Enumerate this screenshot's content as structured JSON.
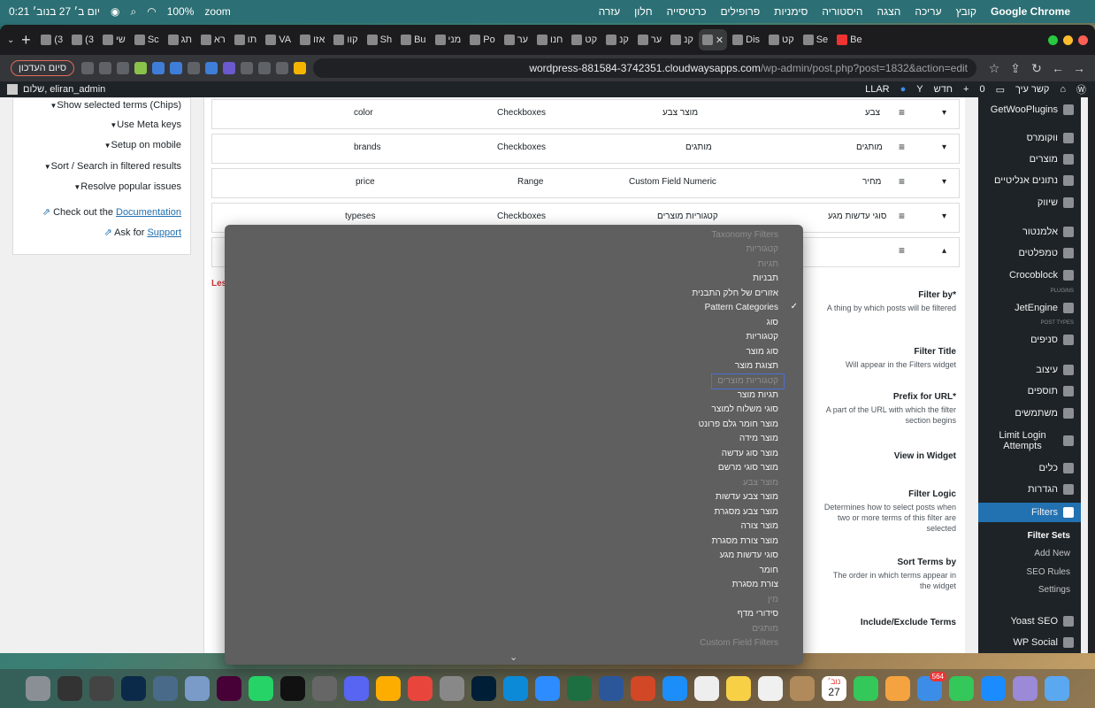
{
  "menubar": {
    "app": "Google Chrome",
    "menus": [
      "קובץ",
      "עריכה",
      "הצגה",
      "היסטוריה",
      "סימניות",
      "פרופילים",
      "כרטיסייה",
      "חלון",
      "עזרה"
    ],
    "status": {
      "zoom": "zoom",
      "battery": "100%",
      "datetime": "יום ב׳ 27 בנוב׳ 0:21"
    }
  },
  "tabs": [
    "Be",
    "Se",
    "קט",
    "Dis",
    "קנ",
    "ער",
    "קנ",
    "קט",
    "חנו",
    "ער",
    "Po",
    "מני",
    "Bu",
    "Sh",
    "קוו",
    "אזו",
    "VA",
    "תו",
    "רא",
    "תג",
    "Sc",
    "שי",
    "(3",
    "(3"
  ],
  "url": {
    "host": "wordpress-881584-3742351.cloudwaysapps.com",
    "path": "/wp-admin/post.php?post=1832&action=edit"
  },
  "profile_button": "סיום העדכון",
  "adminbar": {
    "site": "קשר עיך",
    "comments": "0",
    "new": "חדש",
    "llar": "LLAR",
    "greeting": "שלום, eliran_admin"
  },
  "left_options": [
    "Show selected terms (Chips)",
    "Use Meta keys",
    "Setup on mobile",
    "Sort / Search in filtered results",
    "Resolve popular issues"
  ],
  "links": {
    "doc_text": "Check out the",
    "doc_link": "Documentation",
    "support_text": "Ask for",
    "support_link": "Support"
  },
  "filter_rows": [
    {
      "name": "צבע",
      "source": "מוצר צבע",
      "view": "Checkboxes",
      "slug": "color"
    },
    {
      "name": "מותגים",
      "source": "מותגים",
      "view": "Checkboxes",
      "slug": "brands"
    },
    {
      "name": "מחיר",
      "source": "Custom Field Numeric",
      "view": "Range",
      "slug": "price"
    },
    {
      "name": "סוגי עדשות מגע",
      "source": "קטגוריות מוצרים",
      "view": "Checkboxes",
      "slug": "typeses"
    }
  ],
  "less_link": "Les",
  "settings": [
    {
      "label": "Filter by*",
      "desc": "A thing by which posts will be filtered"
    },
    {
      "label": "Filter Title",
      "desc": "Will appear in the Filters widget"
    },
    {
      "label": "Prefix for URL*",
      "desc": "A part of the URL with which the filter section begins"
    },
    {
      "label": "View in Widget",
      "desc": ""
    },
    {
      "label": "Filter Logic",
      "desc": "Determines how to select posts when two or more terms of this filter are selected"
    },
    {
      "label": "Sort Terms by",
      "desc": "The order in which terms appear in the widget"
    },
    {
      "label": "Include/Exclude Terms",
      "desc": ""
    }
  ],
  "sidebar": {
    "items": [
      "GetWooPlugins",
      "ווקומרס",
      "מוצרים",
      "נתונים אנליטיים",
      "שיווק",
      "אלמנטור",
      "טמפלטים",
      "Crocoblock",
      "JetEngine",
      "סניפים",
      "עיצוב",
      "תוספים",
      "משתמשים",
      "Limit Login Attempts",
      "כלים",
      "הגדרות",
      "Filters",
      "Yoast SEO",
      "WP Social"
    ],
    "sub": [
      "Filter Sets",
      "Add New",
      "SEO Rules",
      "Settings"
    ],
    "badges": [
      "PLUGINS",
      "POST TYPES"
    ]
  },
  "dropdown": {
    "items": [
      {
        "label": "Taxonomy Filters",
        "disabled": true
      },
      {
        "label": "קטגוריות",
        "disabled": true
      },
      {
        "label": "תגיות",
        "disabled": true
      },
      {
        "label": "תבניות",
        "disabled": false
      },
      {
        "label": "אזורים של חלק התבנית",
        "disabled": false
      },
      {
        "label": "Pattern Categories",
        "disabled": false,
        "checked": true
      },
      {
        "label": "סוג",
        "disabled": false
      },
      {
        "label": "קטגוריות",
        "disabled": false
      },
      {
        "label": "סוג מוצר",
        "disabled": false
      },
      {
        "label": "תצוגת מוצר",
        "disabled": false
      },
      {
        "label": "קטגוריות מוצרים",
        "disabled": true,
        "highlighted": true
      },
      {
        "label": "תגיות מוצר",
        "disabled": false
      },
      {
        "label": "סוגי משלוח למוצר",
        "disabled": false
      },
      {
        "label": "מוצר חומר גלם פרונט",
        "disabled": false
      },
      {
        "label": "מוצר מידה",
        "disabled": false
      },
      {
        "label": "מוצר סוג עדשה",
        "disabled": false
      },
      {
        "label": "מוצר סוגי מרשם",
        "disabled": false
      },
      {
        "label": "מוצר צבע",
        "disabled": true
      },
      {
        "label": "מוצר צבע עדשות",
        "disabled": false
      },
      {
        "label": "מוצר צבע מסגרת",
        "disabled": false
      },
      {
        "label": "מוצר צורה",
        "disabled": false
      },
      {
        "label": "מוצר צורת מסגרת",
        "disabled": false
      },
      {
        "label": "סוגי עדשות מגע",
        "disabled": false
      },
      {
        "label": "חומר",
        "disabled": false
      },
      {
        "label": "צורת מסגרת",
        "disabled": false
      },
      {
        "label": "מין",
        "disabled": true
      },
      {
        "label": "סידורי מדף",
        "disabled": false
      },
      {
        "label": "מותגים",
        "disabled": true
      },
      {
        "label": "Custom Field Filters",
        "disabled": true
      }
    ]
  },
  "dock": {
    "calendar_day": "27",
    "calendar_month": "נוב׳",
    "mail_badge": "564"
  }
}
